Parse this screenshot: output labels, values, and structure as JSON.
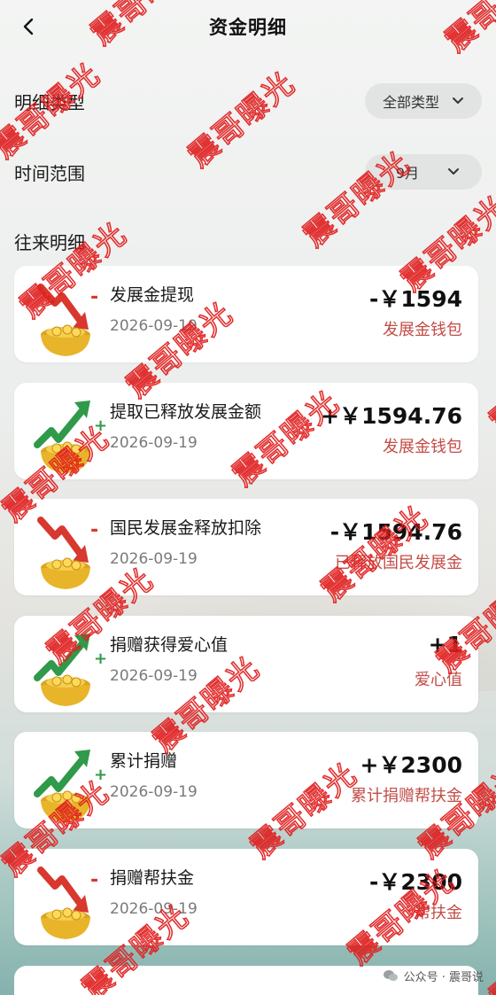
{
  "header": {
    "title": "资金明细"
  },
  "filters": {
    "type_label": "明细类型",
    "type_value": "全部类型",
    "time_label": "时间范围",
    "time_value": "9月"
  },
  "section": {
    "label": "往来明细"
  },
  "records": [
    {
      "name": "发展金提现",
      "date": "2026-09-19",
      "amount": "-￥1594",
      "account": "发展金钱包",
      "direction": "down"
    },
    {
      "name": "提取已释放发展金额",
      "date": "2026-09-19",
      "amount": "+￥1594.76",
      "account": "发展金钱包",
      "direction": "up"
    },
    {
      "name": "国民发展金释放扣除",
      "date": "2026-09-19",
      "amount": "-￥1594.76",
      "account": "已释放国民发展金",
      "direction": "down"
    },
    {
      "name": "捐赠获得爱心值",
      "date": "2026-09-19",
      "amount": "+1",
      "account": "爱心值",
      "direction": "up"
    },
    {
      "name": "累计捐赠",
      "date": "2026-09-19",
      "amount": "+￥2300",
      "account": "累计捐赠帮扶金",
      "direction": "up"
    },
    {
      "name": "捐赠帮扶金",
      "date": "2026-09-19",
      "amount": "-￥2300",
      "account": "帮扶金",
      "direction": "down"
    }
  ],
  "footer": {
    "source": "公众号 · 震哥说"
  },
  "watermark": {
    "text": "震哥曝光"
  },
  "colors": {
    "account_red": "#c24d47",
    "arrow_up_green": "#2f9a4a",
    "arrow_down_red": "#d8382e",
    "watermark_red": "#e02020"
  }
}
